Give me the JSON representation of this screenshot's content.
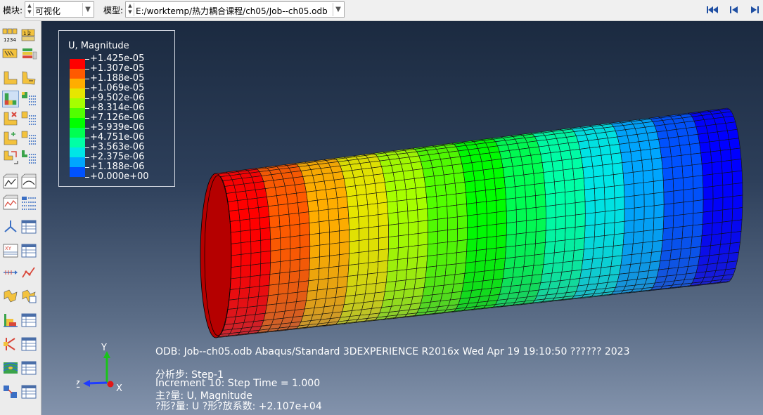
{
  "toolbar": {
    "module_label": "模块:",
    "module_value": "可视化",
    "model_label": "模型:",
    "model_value": "E:/worktemp/热力耦合课程/ch05/Job--ch05.odb"
  },
  "nav_icons": [
    "first-frame-icon",
    "previous-frame-icon",
    "next-frame-icon"
  ],
  "legend": {
    "title": "U, Magnitude",
    "levels": [
      "+1.425e-05",
      "+1.307e-05",
      "+1.188e-05",
      "+1.069e-05",
      "+9.502e-06",
      "+8.314e-06",
      "+7.126e-06",
      "+5.939e-06",
      "+4.751e-06",
      "+3.563e-06",
      "+2.375e-06",
      "+1.188e-06",
      "+0.000e+00"
    ],
    "colors": [
      "#ff0000",
      "#ff5a00",
      "#ffad00",
      "#e6e600",
      "#a6ff00",
      "#52ff00",
      "#00ff00",
      "#00ff52",
      "#00ffa6",
      "#00e6e6",
      "#00a6ff",
      "#0052ff",
      "#0000ff"
    ]
  },
  "info": {
    "odb_line": "ODB: Job--ch05.odb    Abaqus/Standard 3DEXPERIENCE R2016x    Wed Apr 19 19:10:50 ?????? 2023",
    "step_line": "分析步: Step-1",
    "increment_line": "Increment     10: Step Time =    1.000",
    "primary_line": "主?量: U, Magnitude",
    "deformed_line": "?形?量: U   ?形?放系数: +2.107e+04"
  },
  "triad": {
    "y": "Y",
    "z": "Z",
    "x": "X"
  }
}
